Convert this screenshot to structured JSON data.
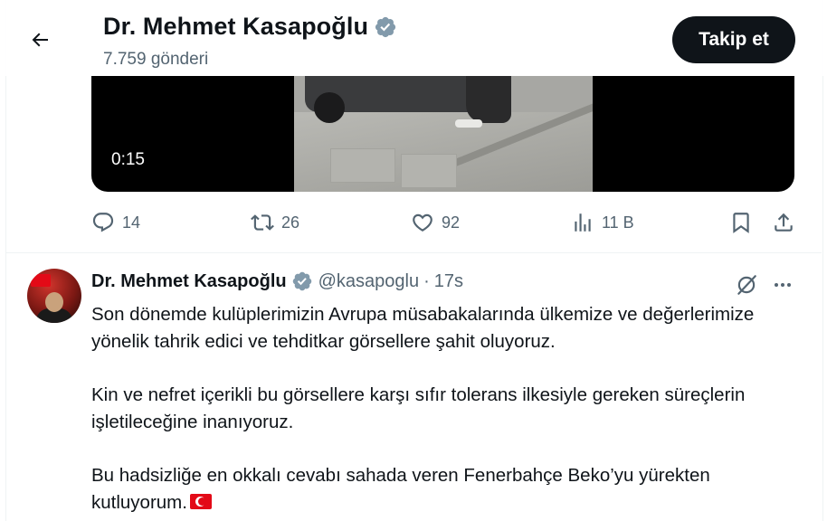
{
  "header": {
    "display_name": "Dr. Mehmet Kasapoğlu",
    "post_count": "7.759 gönderi",
    "follow_label": "Takip et"
  },
  "video": {
    "duration": "0:15"
  },
  "actions": {
    "replies": "14",
    "reposts": "26",
    "likes": "92",
    "views": "11 B"
  },
  "tweet": {
    "display_name": "Dr. Mehmet Kasapoğlu",
    "handle": "@kasapoglu",
    "separator": "·",
    "time": "17s",
    "paragraph_1": "Son dönemde kulüplerimizin Avrupa müsabakalarında ülkemize ve değerlerimize yönelik tahrik edici ve tehditkar görsellere şahit oluyoruz.",
    "paragraph_2": "Kin ve nefret içerikli bu görsellere karşı sıfır tolerans ilkesiyle gereken süreçlerin işletileceğine inanıyoruz.",
    "paragraph_3": "Bu hadsizliğe en okkalı cevabı sahada veren Fenerbahçe Beko’yu yürekten kutluyorum.",
    "emoji": "turkey-flag-emoji"
  },
  "colors": {
    "text_primary": "#0f1419",
    "text_secondary": "#536471",
    "verified_badge": "#829aab",
    "follow_button_bg": "#0f1419",
    "divider": "#eff3f4"
  }
}
